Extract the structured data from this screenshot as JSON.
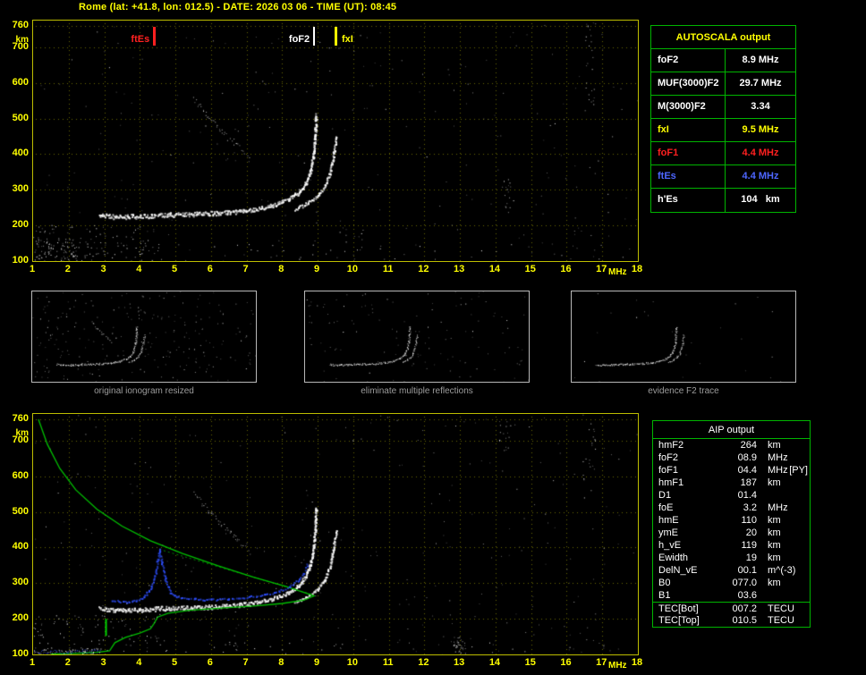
{
  "header": {
    "title": "Rome (lat: +41.8, lon: 012.5) - DATE: 2026 03 06 - TIME (UT): 08:45"
  },
  "top_markers": [
    {
      "label": "ftEs",
      "freq": 4.4,
      "color": "#ff2020",
      "side": "left"
    },
    {
      "label": "foF2",
      "freq": 8.9,
      "color": "#ffffff",
      "side": "left"
    },
    {
      "label": "fxI",
      "freq": 9.5,
      "color": "#ffff00",
      "side": "right"
    }
  ],
  "autoscala_table": {
    "title": "AUTOSCALA output",
    "rows": [
      {
        "param": "foF2",
        "value": "8.9 MHz",
        "color": "#ffffff"
      },
      {
        "param": "MUF(3000)F2",
        "value": "29.7 MHz",
        "color": "#ffffff"
      },
      {
        "param": "M(3000)F2",
        "value": "3.34",
        "color": "#ffffff"
      },
      {
        "param": "fxI",
        "value": "9.5 MHz",
        "color": "#ffff00"
      },
      {
        "param": "foF1",
        "value": "4.4 MHz",
        "color": "#ff2020"
      },
      {
        "param": "ftEs",
        "value": "4.4 MHz",
        "color": "#4d66ff"
      },
      {
        "param": "h'Es",
        "value": "104   km",
        "color": "#ffffff"
      }
    ]
  },
  "thumbnails": [
    {
      "caption": "original ionogram resized"
    },
    {
      "caption": "eliminate multiple reflections"
    },
    {
      "caption": "evidence F2 trace"
    }
  ],
  "aip_table": {
    "title": "AIP output",
    "rows": [
      {
        "param": "hmF2",
        "value": "264",
        "unit": "km",
        "extra": ""
      },
      {
        "param": "foF2",
        "value": "08.9",
        "unit": "MHz",
        "extra": ""
      },
      {
        "param": "foF1",
        "value": "04.4",
        "unit": "MHz",
        "extra": "[PY]"
      },
      {
        "param": "hmF1",
        "value": "187",
        "unit": "km",
        "extra": ""
      },
      {
        "param": "D1",
        "value": "01.4",
        "unit": "",
        "extra": ""
      },
      {
        "param": "foE",
        "value": "3.2",
        "unit": "MHz",
        "extra": ""
      },
      {
        "param": "hmE",
        "value": "110",
        "unit": "km",
        "extra": ""
      },
      {
        "param": "ymE",
        "value": "20",
        "unit": "km",
        "extra": ""
      },
      {
        "param": "h_vE",
        "value": "119",
        "unit": "km",
        "extra": ""
      },
      {
        "param": "Ewidth",
        "value": "19",
        "unit": "km",
        "extra": ""
      },
      {
        "param": "DelN_vE",
        "value": "00.1",
        "unit": "m^(-3)",
        "extra": ""
      },
      {
        "param": "B0",
        "value": "077.0",
        "unit": "km",
        "extra": ""
      },
      {
        "param": "B1",
        "value": "03.6",
        "unit": "",
        "extra": ""
      },
      {
        "param": "TEC[Bot]",
        "value": "007.2",
        "unit": "TECU",
        "extra": "",
        "sep": true
      },
      {
        "param": "TEC[Top]",
        "value": "010.5",
        "unit": "TECU",
        "extra": ""
      }
    ]
  },
  "chart_data": {
    "type": "scatter",
    "title": "AUTOSCALA ionogram - Rome 2026-03-06 08:45 UT",
    "xlabel": "MHz",
    "ylabel": "km",
    "xlim": [
      1,
      18
    ],
    "ylim": [
      100,
      775
    ],
    "xticks": [
      1,
      2,
      3,
      4,
      5,
      6,
      7,
      8,
      9,
      10,
      11,
      12,
      13,
      14,
      15,
      16,
      17,
      18
    ],
    "yticks": [
      100,
      200,
      300,
      400,
      500,
      600,
      700,
      760
    ],
    "grid": "dotted yellow",
    "scaled_values": {
      "foF2_MHz": 8.9,
      "MUF3000F2_MHz": 29.7,
      "M3000F2": 3.34,
      "fxI_MHz": 9.5,
      "foF1_MHz": 4.4,
      "ftEs_MHz": 4.4,
      "hEs_km": 104,
      "hmF2_km": 264,
      "hmF1_km": 187,
      "hmE_km": 110,
      "foE_MHz": 3.2,
      "ymE_km": 20,
      "h_vE_km": 119,
      "Ewidth_km": 19,
      "DelN_vE": 0.1,
      "B0_km": 77.0,
      "B1": 3.6,
      "TEC_bot_TECU": 7.2,
      "TEC_top_TECU": 10.5,
      "D1": 1.4
    },
    "trace_defs": {
      "f_flat": {
        "style": "cloud",
        "color": "#ffffff",
        "size": 2,
        "jitter": 5,
        "step": 0.8,
        "points": [
          [
            2.85,
            231
          ],
          [
            3.3,
            225
          ],
          [
            4.0,
            227
          ],
          [
            4.8,
            231
          ],
          [
            5.6,
            233
          ],
          [
            6.4,
            237
          ],
          [
            7.1,
            244
          ]
        ]
      },
      "f2_o": {
        "style": "cloud",
        "color": "#ffffff",
        "size": 2,
        "jitter": 4,
        "step": 0.8,
        "points": [
          [
            7.1,
            244
          ],
          [
            7.7,
            257
          ],
          [
            8.15,
            273
          ],
          [
            8.45,
            293
          ],
          [
            8.65,
            319
          ],
          [
            8.78,
            353
          ],
          [
            8.87,
            400
          ],
          [
            8.92,
            455
          ],
          [
            8.94,
            512
          ]
        ]
      },
      "f2_x": {
        "style": "cloud",
        "color": "#ffffff",
        "size": 2,
        "jitter": 3,
        "step": 1.1,
        "points": [
          [
            8.35,
            247
          ],
          [
            8.7,
            263
          ],
          [
            9.0,
            285
          ],
          [
            9.2,
            313
          ],
          [
            9.33,
            349
          ],
          [
            9.42,
            391
          ],
          [
            9.48,
            431
          ],
          [
            9.51,
            452
          ]
        ]
      },
      "hop": {
        "style": "cloud",
        "color": "#d8d8d8",
        "size": 1,
        "jitter": 7,
        "step": 2.2,
        "points": [
          [
            5.5,
            555
          ],
          [
            5.9,
            508
          ],
          [
            6.3,
            464
          ],
          [
            6.7,
            427
          ],
          [
            7.05,
            400
          ]
        ]
      },
      "profile": {
        "style": "line",
        "color": "#00c000",
        "width": 1.3,
        "points": [
          [
            1.15,
            760
          ],
          [
            1.4,
            690
          ],
          [
            1.75,
            622
          ],
          [
            2.2,
            562
          ],
          [
            2.8,
            507
          ],
          [
            3.5,
            460
          ],
          [
            4.3,
            419
          ],
          [
            5.2,
            383
          ],
          [
            6.2,
            349
          ],
          [
            7.2,
            317
          ],
          [
            8.1,
            291
          ],
          [
            8.65,
            273
          ],
          [
            8.9,
            264
          ],
          [
            8.6,
            252
          ],
          [
            8.0,
            243
          ],
          [
            7.2,
            236
          ],
          [
            6.3,
            230
          ],
          [
            5.4,
            224
          ],
          [
            4.8,
            216
          ],
          [
            4.5,
            205
          ],
          [
            4.4,
            187
          ],
          [
            4.3,
            172
          ],
          [
            4.0,
            160
          ],
          [
            3.6,
            148
          ],
          [
            3.3,
            133
          ],
          [
            3.2,
            118
          ],
          [
            3.15,
            110
          ],
          [
            2.8,
            106
          ],
          [
            2.2,
            103
          ],
          [
            1.5,
            101
          ]
        ]
      },
      "profile_chord": {
        "style": "line",
        "color": "#00a000",
        "width": 1,
        "alpha": 0.85,
        "dash": [
          2,
          3
        ],
        "points": [
          [
            4.55,
            395
          ],
          [
            8.85,
            268
          ]
        ]
      },
      "blue_cusp": {
        "style": "cloud",
        "color": "#2e4fff",
        "size": 2,
        "jitter": 2,
        "step": 1.8,
        "points": [
          [
            3.2,
            252
          ],
          [
            3.6,
            249
          ],
          [
            3.9,
            253
          ],
          [
            4.1,
            262
          ],
          [
            4.3,
            286
          ],
          [
            4.42,
            322
          ],
          [
            4.5,
            370
          ],
          [
            4.55,
            396
          ],
          [
            4.6,
            362
          ],
          [
            4.7,
            312
          ],
          [
            4.85,
            276
          ],
          [
            5.0,
            263
          ]
        ]
      },
      "blue_flat": {
        "style": "cloud",
        "color": "#2e4fff",
        "size": 2,
        "jitter": 2,
        "step": 2.4,
        "points": [
          [
            5.0,
            263
          ],
          [
            5.5,
            257
          ],
          [
            6.0,
            255
          ],
          [
            6.5,
            257
          ],
          [
            7.0,
            262
          ],
          [
            7.5,
            269
          ],
          [
            7.9,
            279
          ],
          [
            8.2,
            291
          ],
          [
            8.45,
            309
          ],
          [
            8.6,
            331
          ],
          [
            8.7,
            356
          ]
        ]
      },
      "blue_base": {
        "style": "cloud",
        "color": "#3b54ff",
        "size": 1,
        "jitter": 4,
        "step": 1.6,
        "points": [
          [
            1.05,
            108
          ],
          [
            2.0,
            108
          ],
          [
            2.85,
            111
          ]
        ]
      },
      "green_tick": {
        "style": "line",
        "color": "#00d000",
        "width": 2,
        "points": [
          [
            3.05,
            200
          ],
          [
            3.05,
            152
          ]
        ]
      }
    },
    "plots": {
      "top": {
        "canvas": "top-ionogram-canvas",
        "seed": 11,
        "grid": true,
        "scale": 1,
        "traces": [
          "f_flat",
          "f2_o",
          "f2_x",
          "hop"
        ],
        "noise": {
          "count": 240
        },
        "clusters": [
          {
            "f": [
              1.0,
              4.6
            ],
            "k": [
              100,
              205
            ],
            "count": 120
          },
          {
            "f": [
              1.0,
              2.3
            ],
            "k": [
              100,
              160
            ],
            "count": 60
          },
          {
            "f": [
              1.0,
              17.9
            ],
            "k": [
              100,
              150
            ],
            "count": 55
          },
          {
            "f": [
              16.5,
              16.8
            ],
            "k": [
              540,
              775
            ],
            "count": 26
          },
          {
            "f": [
              14.1,
              14.5
            ],
            "k": [
              235,
              330
            ],
            "count": 16
          },
          {
            "f": [
              9.6,
              10.3
            ],
            "k": [
              100,
              215
            ],
            "count": 12
          }
        ]
      },
      "bottom": {
        "canvas": "bottom-ionogram-canvas",
        "seed": 29,
        "grid": true,
        "scale": 1,
        "traces": [
          "f_flat",
          "f2_o",
          "f2_x",
          "hop",
          "profile_chord",
          "profile",
          "blue_cusp",
          "blue_flat",
          "blue_base",
          "green_tick"
        ],
        "noise": {
          "count": 280
        },
        "clusters": [
          {
            "f": [
              1.0,
              4.6
            ],
            "k": [
              130,
              215
            ],
            "count": 70
          },
          {
            "f": [
              1.0,
              2.9
            ],
            "k": [
              100,
              120
            ],
            "count": 70
          },
          {
            "f": [
              1.0,
              17.9
            ],
            "k": [
              100,
              145
            ],
            "count": 55
          },
          {
            "f": [
              12.8,
              13.15
            ],
            "k": [
              105,
              150
            ],
            "count": 30
          },
          {
            "f": [
              16.45,
              16.8
            ],
            "k": [
              540,
              775
            ],
            "count": 22
          },
          {
            "f": [
              14.1,
              14.4
            ],
            "k": [
              660,
              775
            ],
            "count": 14
          }
        ]
      },
      "thumb1": {
        "canvas": "thumb1-canvas",
        "seed": 3,
        "grid": false,
        "scale": 0.4,
        "traces": [
          "f_flat",
          "f2_o",
          "f2_x",
          "hop"
        ],
        "noise": {
          "count": 240
        },
        "clusters": []
      },
      "thumb2": {
        "canvas": "thumb2-canvas",
        "seed": 5,
        "grid": false,
        "scale": 0.4,
        "traces": [
          "f_flat",
          "f2_o",
          "f2_x"
        ],
        "noise": {
          "count": 130
        },
        "clusters": []
      },
      "thumb3": {
        "canvas": "thumb3-canvas",
        "seed": 9,
        "grid": false,
        "scale": 0.4,
        "traces": [
          "f_flat",
          "f2_o",
          "f2_x"
        ],
        "noise": {
          "count": 28
        },
        "clusters": []
      }
    }
  }
}
